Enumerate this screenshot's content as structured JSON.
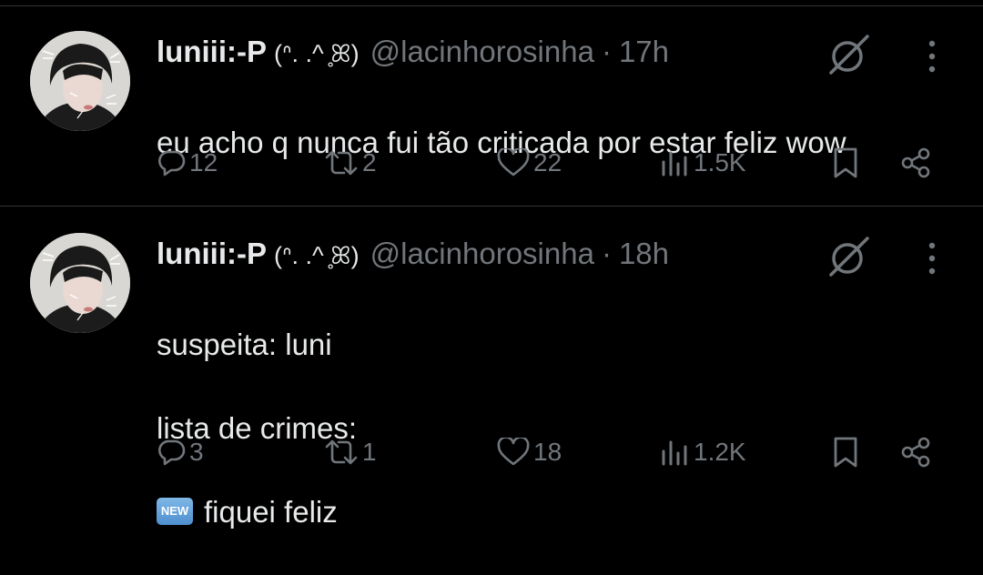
{
  "colors": {
    "background": "#000000",
    "text_primary": "#e7e9ea",
    "text_secondary": "#71767b",
    "divider": "#2f3336",
    "new_badge": "#5b9bd5"
  },
  "tweets": [
    {
      "display_name": "luniii:-P",
      "kaomoji": "(ᐢ. .^ ̥ꕤ)",
      "handle": "@lacinhorosinha",
      "separator": "·",
      "time": "17h",
      "text_lines": [
        "eu acho q nunca fui tão criticada por estar feliz wow"
      ],
      "badge": "",
      "stats": {
        "replies": "12",
        "reposts": "2",
        "likes": "22",
        "views": "1.5K"
      },
      "icons": [
        "reply-icon",
        "repost-icon",
        "like-icon",
        "views-icon",
        "bookmark-icon",
        "share-icon",
        "grok-icon",
        "more-icon"
      ]
    },
    {
      "display_name": "luniii:-P",
      "kaomoji": "(ᐢ. .^ ̥ꕤ)",
      "handle": "@lacinhorosinha",
      "separator": "·",
      "time": "18h",
      "text_lines": [
        "suspeita: luni",
        "lista de crimes:",
        "fiquei feliz"
      ],
      "badge": "NEW",
      "stats": {
        "replies": "3",
        "reposts": "1",
        "likes": "18",
        "views": "1.2K"
      },
      "icons": [
        "reply-icon",
        "repost-icon",
        "like-icon",
        "views-icon",
        "bookmark-icon",
        "share-icon",
        "grok-icon",
        "more-icon"
      ]
    }
  ]
}
